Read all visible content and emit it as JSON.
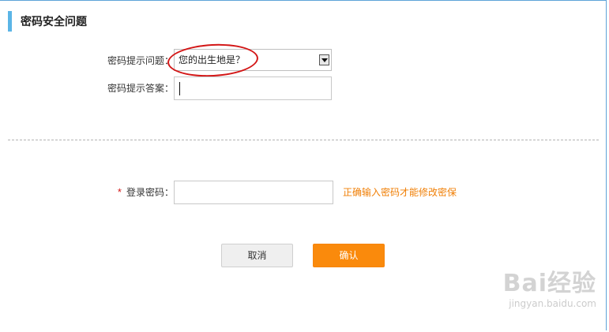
{
  "section": {
    "title": "密码安全问题"
  },
  "form": {
    "question_label": "密码提示问题：",
    "question_value": "您的出生地是？",
    "answer_label": "密码提示答案：",
    "answer_value": "",
    "required_mark": "*",
    "password_label": "登录密码：",
    "password_value": "",
    "password_hint": "正确输入密码才能修改密保"
  },
  "buttons": {
    "cancel": "取消",
    "confirm": "确认"
  },
  "watermark": {
    "brand": "Bai经验",
    "paw": "du",
    "url": "jingyan.baidu.com"
  },
  "colors": {
    "accent": "#5bb5e6",
    "primary_button": "#fa8a0c",
    "hint": "#f07f06",
    "required": "#d31616",
    "annotation": "#d31616"
  }
}
